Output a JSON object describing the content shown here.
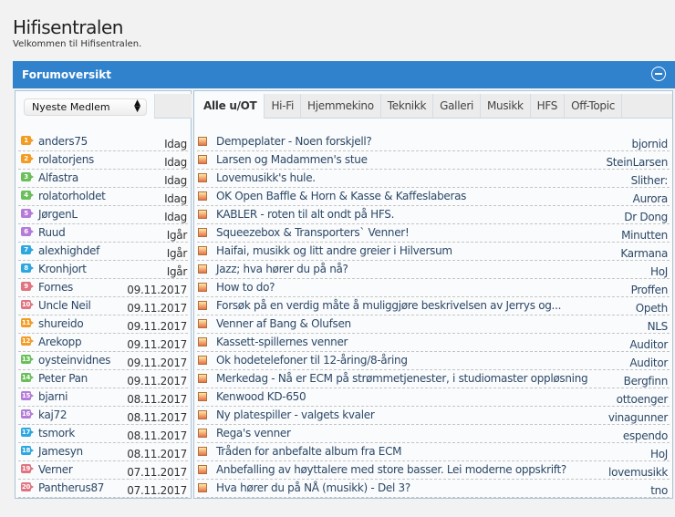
{
  "header": {
    "title": "Hifisentralen",
    "subtitle": "Velkommen til Hifisentralen."
  },
  "bar": {
    "title": "Forumoversikt",
    "collapse_icon": "minus-circle-icon"
  },
  "members": {
    "select_value": "Nyeste Medlem",
    "badge_colors": {
      "orange": "#f39c24",
      "green": "#6bbf5a",
      "purple": "#b57bd8",
      "blue": "#2ea7e0",
      "red": "#e07480"
    },
    "items": [
      {
        "rank": "1",
        "name": "anders75",
        "date": "Idag",
        "color": "#f39c24"
      },
      {
        "rank": "2",
        "name": "rolatorjens",
        "date": "Idag",
        "color": "#f39c24"
      },
      {
        "rank": "3",
        "name": "Alfastra",
        "date": "Idag",
        "color": "#6bbf5a"
      },
      {
        "rank": "4",
        "name": "rolatorholdet",
        "date": "Idag",
        "color": "#6bbf5a"
      },
      {
        "rank": "5",
        "name": "JørgenL",
        "date": "Idag",
        "color": "#b57bd8"
      },
      {
        "rank": "6",
        "name": "Ruud",
        "date": "Igår",
        "color": "#b57bd8"
      },
      {
        "rank": "7",
        "name": "alexhighdef",
        "date": "Igår",
        "color": "#2ea7e0"
      },
      {
        "rank": "8",
        "name": "Kronhjort",
        "date": "Igår",
        "color": "#2ea7e0"
      },
      {
        "rank": "9",
        "name": "Fornes",
        "date": "09.11.2017",
        "color": "#e07480"
      },
      {
        "rank": "10",
        "name": "Uncle Neil",
        "date": "09.11.2017",
        "color": "#e07480"
      },
      {
        "rank": "11",
        "name": "shureido",
        "date": "09.11.2017",
        "color": "#f39c24"
      },
      {
        "rank": "12",
        "name": "Arekopp",
        "date": "09.11.2017",
        "color": "#f39c24"
      },
      {
        "rank": "13",
        "name": "oysteinvidnes",
        "date": "09.11.2017",
        "color": "#6bbf5a"
      },
      {
        "rank": "14",
        "name": "Peter Pan",
        "date": "09.11.2017",
        "color": "#6bbf5a"
      },
      {
        "rank": "15",
        "name": "bjarni",
        "date": "08.11.2017",
        "color": "#b57bd8"
      },
      {
        "rank": "16",
        "name": "kaj72",
        "date": "08.11.2017",
        "color": "#b57bd8"
      },
      {
        "rank": "17",
        "name": "tsmork",
        "date": "08.11.2017",
        "color": "#2ea7e0"
      },
      {
        "rank": "18",
        "name": "Jamesyn",
        "date": "08.11.2017",
        "color": "#2ea7e0"
      },
      {
        "rank": "19",
        "name": "Verner",
        "date": "07.11.2017",
        "color": "#e07480"
      },
      {
        "rank": "20",
        "name": "Pantherus87",
        "date": "07.11.2017",
        "color": "#e07480"
      }
    ]
  },
  "tabs": [
    {
      "label": "Alle u/OT",
      "active": true
    },
    {
      "label": "Hi-Fi"
    },
    {
      "label": "Hjemmekino"
    },
    {
      "label": "Teknikk"
    },
    {
      "label": "Galleri"
    },
    {
      "label": "Musikk"
    },
    {
      "label": "HFS"
    },
    {
      "label": "Off-Topic"
    }
  ],
  "topics": [
    {
      "title": "Dempeplater - Noen forskjell?",
      "author": "bjornid"
    },
    {
      "title": "Larsen og Madammen's stue",
      "author": "SteinLarsen"
    },
    {
      "title": "Lovemusikk's hule.",
      "author": "Slither:"
    },
    {
      "title": "OK Open Baffle & Horn & Kasse & Kaffeslaberas",
      "author": "Aurora"
    },
    {
      "title": "KABLER - roten til alt ondt på HFS.",
      "author": "Dr Dong"
    },
    {
      "title": "Squeezebox & Transporters` Venner!",
      "author": "Minutten"
    },
    {
      "title": "Haifai, musikk og litt andre greier i Hilversum",
      "author": "Karmana"
    },
    {
      "title": "Jazz; hva hører du på nå?",
      "author": "HoJ"
    },
    {
      "title": "How to do?",
      "author": "Proffen"
    },
    {
      "title": "Forsøk på en verdig måte å muliggjøre beskrivelsen av Jerrys og...",
      "author": "Opeth"
    },
    {
      "title": "Venner af Bang & Olufsen",
      "author": "NLS"
    },
    {
      "title": "Kassett-spillernes venner",
      "author": "Auditor"
    },
    {
      "title": "Ok hodetelefoner til 12-åring/8-åring",
      "author": "Auditor"
    },
    {
      "title": "Merkedag - Nå er ECM på strømmetjenester, i studiomaster oppløsning",
      "author": "Bergfinn"
    },
    {
      "title": "Kenwood KD-650",
      "author": "ottoenger"
    },
    {
      "title": "Ny platespiller - valgets kvaler",
      "author": "vinagunner"
    },
    {
      "title": "Rega's venner",
      "author": "espendo"
    },
    {
      "title": "Tråden for anbefalte album fra ECM",
      "author": "HoJ"
    },
    {
      "title": "Anbefalling av høyttalere med store basser. Lei moderne oppskrift?",
      "author": "lovemusikk"
    },
    {
      "title": "Hva hører du på NÅ (musikk) - Del 3?",
      "author": "tno"
    }
  ]
}
